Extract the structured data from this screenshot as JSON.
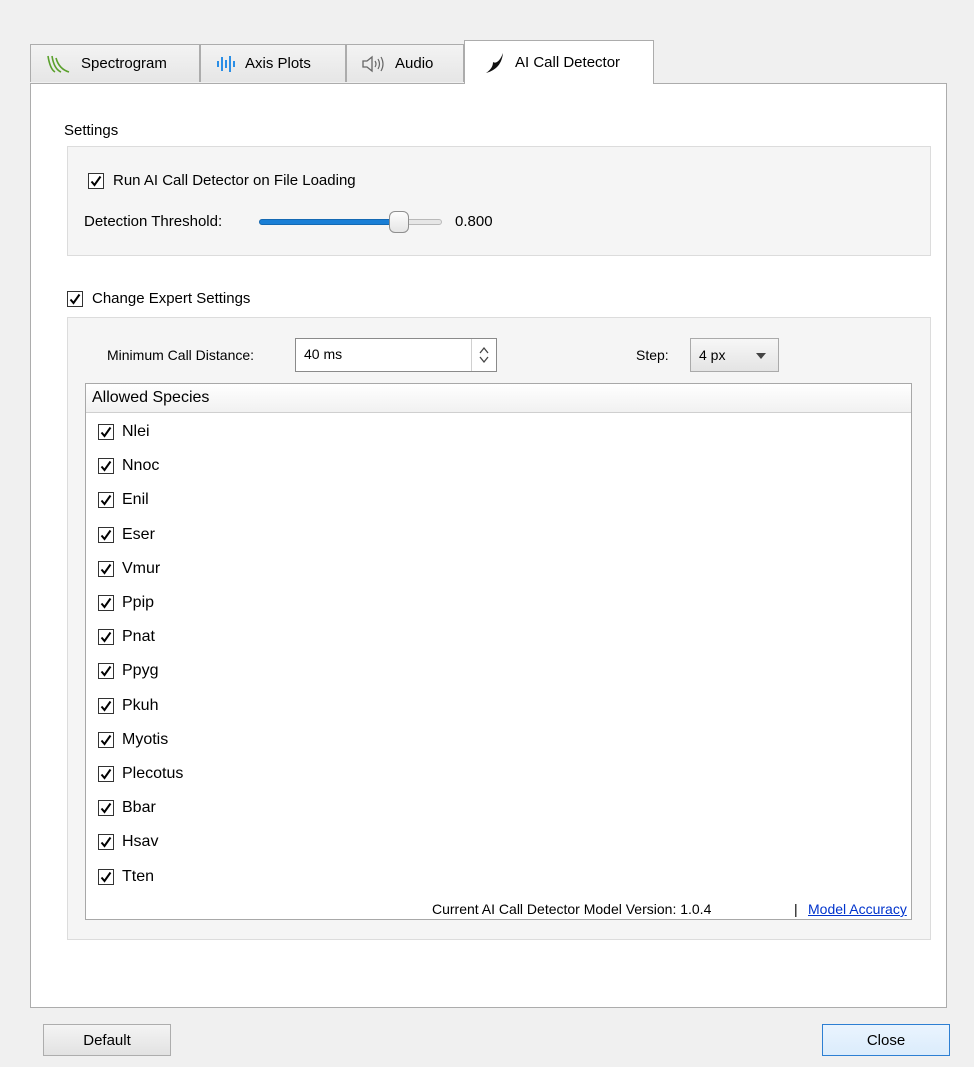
{
  "tabs": [
    {
      "label": "Spectrogram",
      "icon": "spectrogram-icon"
    },
    {
      "label": "Axis Plots",
      "icon": "axis-plots-icon"
    },
    {
      "label": "Audio",
      "icon": "speaker-icon"
    },
    {
      "label": "AI Call Detector",
      "icon": "bat-wing-icon"
    }
  ],
  "settings": {
    "title": "Settings",
    "run_on_load_label": "Run AI Call Detector on File Loading",
    "run_on_load_checked": true,
    "threshold_label": "Detection Threshold:",
    "threshold_value": "0.800",
    "threshold_fraction": 0.8
  },
  "expert": {
    "label": "Change Expert Settings",
    "checked": true,
    "min_call_distance_label": "Minimum Call Distance:",
    "min_call_distance_value": "40 ms",
    "step_label": "Step:",
    "step_value": "4 px",
    "species_header": "Allowed Species",
    "species": [
      "Nlei",
      "Nnoc",
      "Enil",
      "Eser",
      "Vmur",
      "Ppip",
      "Pnat",
      "Ppyg",
      "Pkuh",
      "Myotis",
      "Plecotus",
      "Bbar",
      "Hsav",
      "Tten"
    ]
  },
  "footer": {
    "model_version_text": "Current AI Call Detector Model Version: 1.0.4",
    "separator": "|",
    "model_accuracy_link": "Model Accuracy",
    "default_button": "Default",
    "close_button": "Close"
  },
  "colors": {
    "accent": "#1a7fd6",
    "link": "#0033cc",
    "tab_green": "#5aa02c"
  }
}
